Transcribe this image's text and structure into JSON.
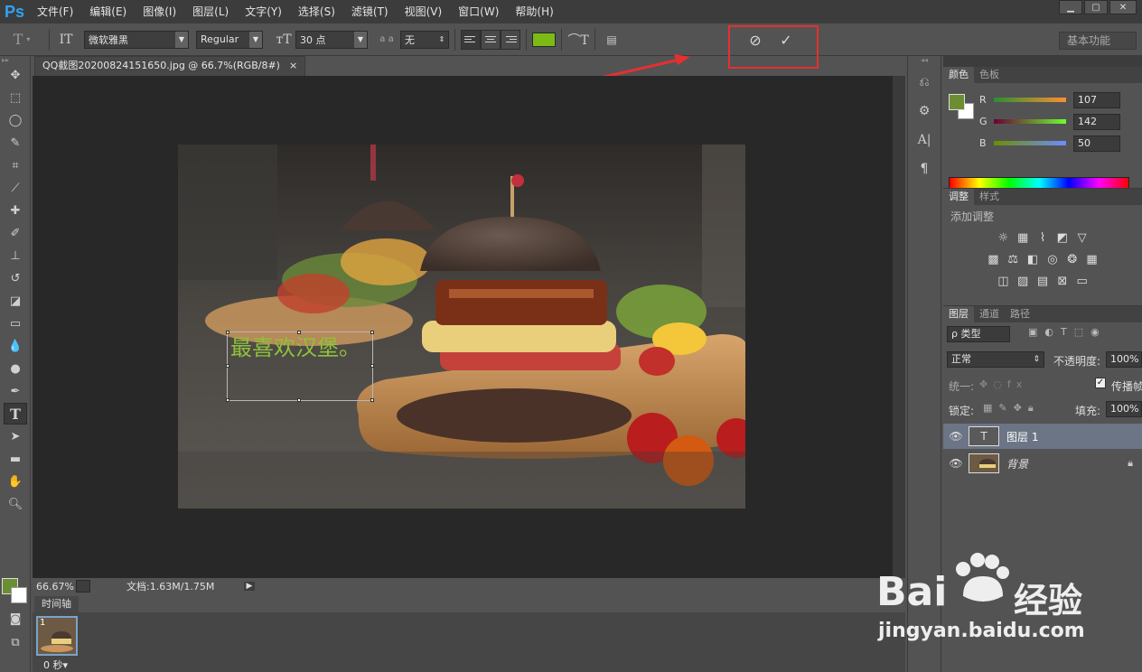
{
  "app": {
    "logo": "Ps",
    "menu": [
      "文件(F)",
      "编辑(E)",
      "图像(I)",
      "图层(L)",
      "文字(Y)",
      "选择(S)",
      "滤镜(T)",
      "视图(V)",
      "窗口(W)",
      "帮助(H)"
    ]
  },
  "options": {
    "font_family": "微软雅黑",
    "font_style": "Regular",
    "font_size": "30 点",
    "aa_label": "a a",
    "antialias": "无",
    "text_color": "#7cbb15",
    "workspace": "基本功能"
  },
  "document": {
    "tab_title": "QQ截图20200824151650.jpg @ 66.7%(RGB/8#)",
    "tab_close": "×",
    "text_layer_content": "最喜欢汉堡。",
    "zoom": "66.67%",
    "doc_info": "文档:1.63M/1.75M"
  },
  "timeline": {
    "tab_label": "时间轴",
    "frame_number": "1",
    "frame_time": "0 秒▾"
  },
  "color_panel": {
    "tabs": [
      "颜色",
      "色板"
    ],
    "channels": [
      {
        "label": "R",
        "value": "107"
      },
      {
        "label": "G",
        "value": "142"
      },
      {
        "label": "B",
        "value": "50"
      }
    ],
    "foreground": "#6b8e32"
  },
  "adjust_panel": {
    "tabs": [
      "调整",
      "样式"
    ],
    "heading": "添加调整"
  },
  "layers_panel": {
    "tabs": [
      "图层",
      "通道",
      "路径"
    ],
    "filter_label": "ρ 类型",
    "blend_mode": "正常",
    "opacity_label": "不透明度:",
    "opacity": "100%",
    "unify_label": "统一:",
    "propagate_label": "传播帧",
    "lock_label": "锁定:",
    "fill_label": "填充:",
    "fill": "100%",
    "layers": [
      {
        "name": "图层 1",
        "thumb": "T"
      },
      {
        "name": "背景",
        "thumb": ""
      }
    ]
  },
  "watermark": {
    "brand": "Bai",
    "brand2": "经验",
    "url": "jingyan.baidu.com"
  }
}
